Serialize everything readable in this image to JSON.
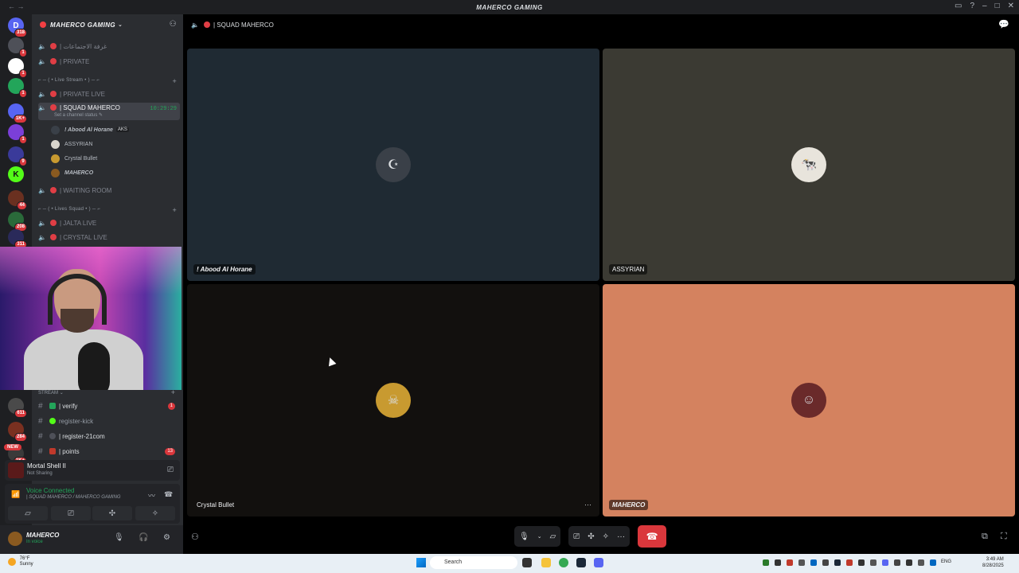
{
  "window": {
    "title": "MAHERCO GAMING"
  },
  "servers": [
    {
      "badge": "318",
      "color": "#5865f2",
      "glyph": "D"
    },
    {
      "badge": "1",
      "color": "#4e5058",
      "glyph": ""
    },
    {
      "badge": "1",
      "color": "#ffffff",
      "glyph": ""
    },
    {
      "badge": "1",
      "color": "#23a55a",
      "glyph": ""
    },
    {
      "badge": "1K+",
      "color": "#5865f2",
      "glyph": ""
    },
    {
      "badge": "1",
      "color": "#7b3fd9",
      "glyph": ""
    },
    {
      "badge": "9",
      "color": "#3a3a9a",
      "glyph": ""
    },
    {
      "badge": "",
      "color": "#53fc18",
      "glyph": "K"
    },
    {
      "badge": "44",
      "color": "#6a3020",
      "glyph": ""
    },
    {
      "badge": "208",
      "color": "#2a6a3a",
      "glyph": ""
    },
    {
      "badge": "311",
      "color": "#2a2a5a",
      "glyph": ""
    }
  ],
  "lower_servers": [
    {
      "badge": "611",
      "color": "#4a4a4a"
    },
    {
      "badge": "284",
      "color": "#7a3020"
    },
    {
      "badge": "1K+",
      "color": "#3a3a3a"
    }
  ],
  "new_badge": "NEW",
  "guild": {
    "name": "MAHERCO GAMING"
  },
  "channels": {
    "meeting_room": "| غرفة الاجتماعات",
    "private": "| PRIVATE",
    "cat_live_stream": "⌐ ─ ( • Live Stream • ) ─ ⌐",
    "private_live": "| PRIVATE LIVE",
    "squad": "| SQUAD MAHERCO",
    "squad_time": "10:29:29",
    "squad_status": "Set a channel status",
    "waiting_room": "| WAITING ROOM",
    "cat_lives_squad": "⌐ ─ ( • Lives Squad • ) ─ ⌐",
    "jalta_live": "| JALTA LIVE",
    "crystal_live": "| CRYSTAL LIVE"
  },
  "members": [
    {
      "name": "! Abood Al Horane",
      "tag": "AKS",
      "italic": true
    },
    {
      "name": "ASSYRIAN",
      "tag": "",
      "italic": false
    },
    {
      "name": "Crystal Bullet",
      "tag": "",
      "italic": false
    },
    {
      "name": "MAHERCO",
      "tag": "",
      "italic": true
    }
  ],
  "stream_category": "STREAM",
  "text_channels": [
    {
      "label": "| verify",
      "count": "1",
      "color": "#23a55a"
    },
    {
      "label": "register-kick",
      "count": "",
      "color": "#53fc18"
    },
    {
      "label": "| register-21com",
      "count": "",
      "color": "#4e5058"
    },
    {
      "label": "| points",
      "count": "13",
      "color": "#c0392b"
    }
  ],
  "activity": {
    "game": "Mortal Shell II",
    "status": "Not Sharing"
  },
  "voice": {
    "status": "Voice Connected",
    "location": "| SQUAD MAHERCO / MAHERCO GAMING"
  },
  "user": {
    "name": "MAHERCO",
    "status": "In voice"
  },
  "stage": {
    "channel": "| SQUAD MAHERCO"
  },
  "tiles": [
    {
      "name": "! Abood Al Horane",
      "bg": "#1f2a33",
      "avatar_bg": "#3a4048",
      "glyph": "☪"
    },
    {
      "name": "ASSYRIAN",
      "bg": "#3b3a33",
      "avatar_bg": "#e8e4dc",
      "glyph": "🐄"
    },
    {
      "name": "Crystal Bullet",
      "bg": "#12100e",
      "avatar_bg": "#c89a30",
      "glyph": "☠"
    },
    {
      "name": "MAHERCO",
      "bg": "#d4825f",
      "avatar_bg": "#6a2a2a",
      "glyph": "☺"
    }
  ],
  "taskbar": {
    "weather_temp": "76°F",
    "weather_desc": "Sunny",
    "search_placeholder": "Search",
    "lang": "ENG",
    "time": "3:49 AM",
    "date": "8/28/2025"
  }
}
